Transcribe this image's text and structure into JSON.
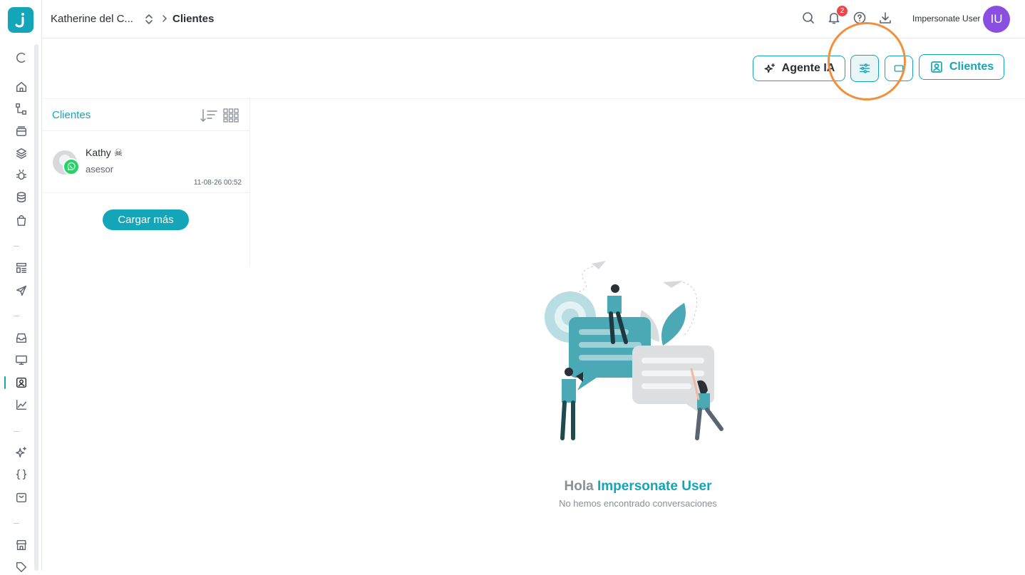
{
  "header": {
    "account": "Katherine del C...",
    "page": "Clientes",
    "notification_count": "2",
    "user_name": "Impersonate User",
    "user_initials": "IU"
  },
  "toolbar": {
    "agent_label": "Agente IA",
    "clients_label": "Clientes"
  },
  "list": {
    "title": "Clientes",
    "items": [
      {
        "name": "Kathy ☠",
        "last_message": "asesor",
        "time": "11-08-26 00:52",
        "channel": "whatsapp"
      }
    ],
    "load_more": "Cargar más"
  },
  "empty_state": {
    "greeting": "Hola",
    "user": "Impersonate User",
    "message": "No hemos encontrado conversaciones"
  },
  "sidebar": {
    "icons": [
      "refresh-icon",
      "home-icon",
      "flow-icon",
      "inbox-stack-icon",
      "layers-icon",
      "bug-icon",
      "database-icon",
      "bag-icon",
      "template-icon",
      "send-icon",
      "inbox-icon",
      "monitor-icon",
      "contacts-icon",
      "chart-icon",
      "sparkle-icon",
      "code-braces-icon",
      "basket-icon",
      "store-icon",
      "tag-icon"
    ]
  },
  "colors": {
    "accent": "#14a5b8",
    "badge": "#e5484d",
    "avatar": "#8a4fe0",
    "highlight": "#f28f3b",
    "whatsapp": "#25d366"
  }
}
